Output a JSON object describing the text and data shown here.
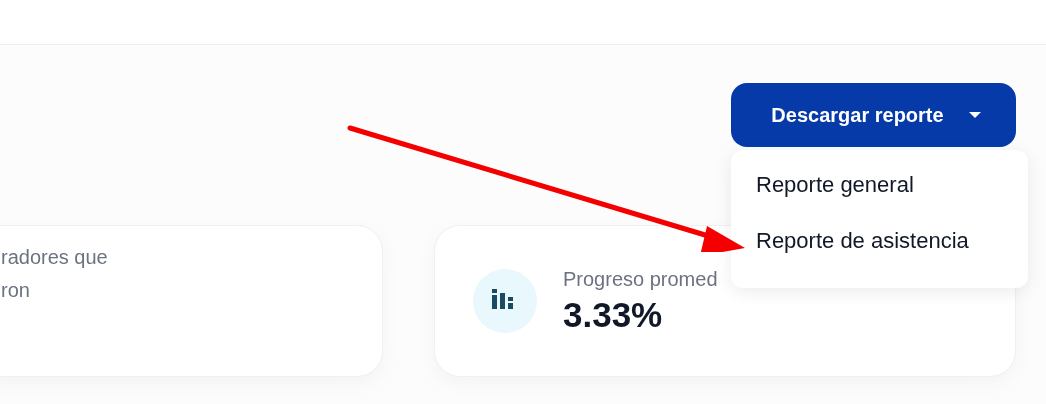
{
  "download_button": {
    "label": "Descargar reporte",
    "expanded": true
  },
  "menu": {
    "items": [
      {
        "label": "Reporte general"
      },
      {
        "label": "Reporte de asistencia"
      }
    ]
  },
  "cards": [
    {
      "label_lines": [
        "radores que",
        "ron"
      ]
    },
    {
      "label": "Progreso promed",
      "value": "3.33%"
    }
  ]
}
